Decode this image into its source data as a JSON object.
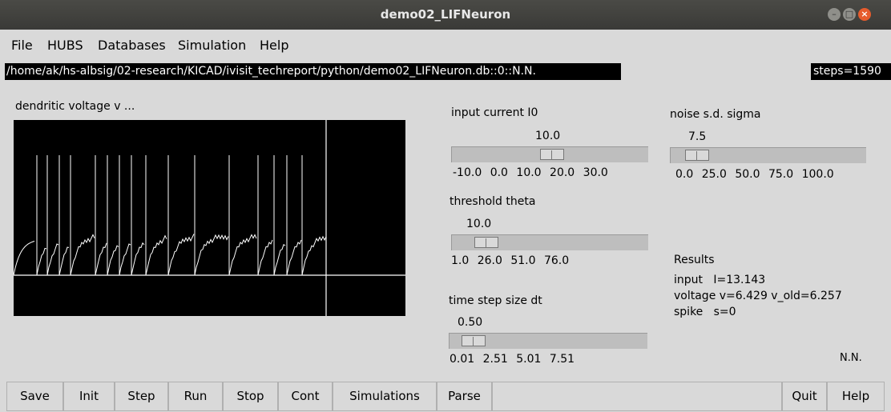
{
  "window": {
    "title": "demo02_LIFNeuron"
  },
  "menu": [
    "File",
    "HUBS",
    "Databases",
    "Simulation",
    "Help"
  ],
  "path": "/home/ak/hs-albsig/02-research/KICAD/ivisit_techreport/python/demo02_LIFNeuron.db::0::N.N.",
  "steps": "steps=1590",
  "plot": {
    "label": "dendritic voltage v ..."
  },
  "sliders": {
    "input_current": {
      "label": "input current I0",
      "value": "10.0",
      "level": 0.5,
      "ticks": [
        "-10.0",
        "0.0",
        "10.0",
        "20.0",
        "30.0"
      ]
    },
    "threshold": {
      "label": "threshold theta",
      "value": "10.0",
      "level": 0.12,
      "ticks": [
        "1.0",
        "26.0",
        "51.0",
        "76.0"
      ]
    },
    "dt": {
      "label": "time step size dt",
      "value": "0.50",
      "level": 0.06,
      "ticks": [
        "0.01",
        "2.51",
        "5.01",
        "7.51"
      ]
    },
    "noise": {
      "label": "noise s.d. sigma",
      "value": "7.5",
      "level": 0.075,
      "ticks": [
        "0.0",
        "25.0",
        "50.0",
        "75.0",
        "100.0"
      ]
    }
  },
  "results": {
    "heading": "Results",
    "input": "input   I=13.143",
    "voltage": "voltage v=6.429 v_old=6.257",
    "spike": "spike   s=0"
  },
  "nn_label": "N.N.",
  "buttons": [
    "Save",
    "Init",
    "Step",
    "Run",
    "Stop",
    "Cont",
    "Simulations",
    "Parse",
    "Quit",
    "Help"
  ],
  "colors": {
    "titlebar": "#3c3b37",
    "close": "#e65c2d",
    "background": "#d9d9d9",
    "plot_bg": "#000000",
    "plot_trace": "#ffffff"
  }
}
